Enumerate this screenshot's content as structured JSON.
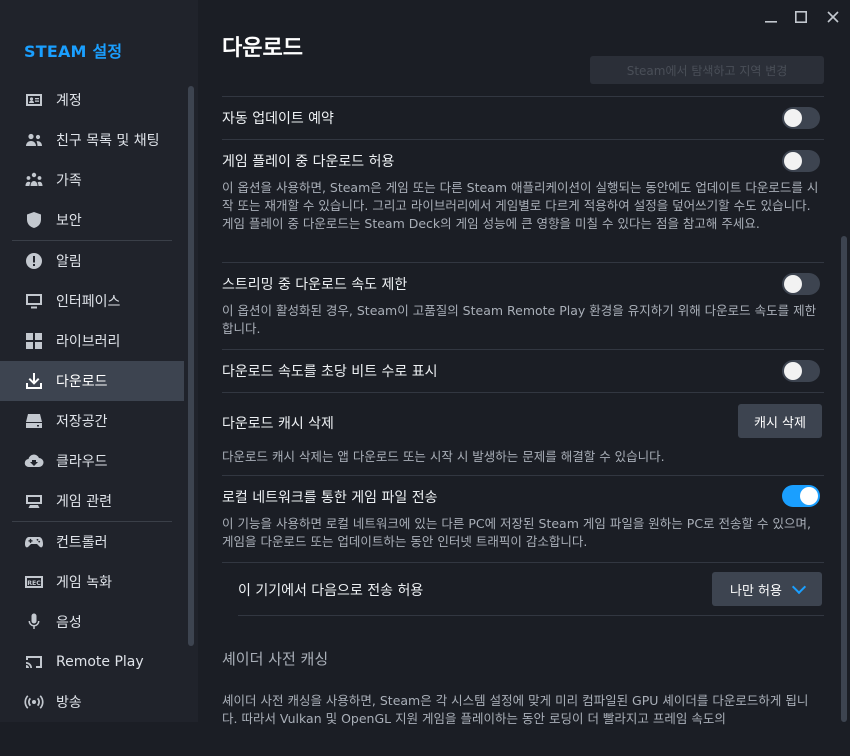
{
  "sidebar": {
    "title": "STEAM 설정",
    "items": [
      {
        "label": "계정",
        "icon": "account-card-icon"
      },
      {
        "label": "친구 목록 및 채팅",
        "icon": "friends-icon"
      },
      {
        "label": "가족",
        "icon": "family-icon"
      },
      {
        "label": "보안",
        "icon": "shield-icon"
      },
      {
        "label": "알림",
        "icon": "alert-icon"
      },
      {
        "label": "인터페이스",
        "icon": "monitor-icon"
      },
      {
        "label": "라이브러리",
        "icon": "grid-icon"
      },
      {
        "label": "다운로드",
        "icon": "download-icon"
      },
      {
        "label": "저장공간",
        "icon": "storage-icon"
      },
      {
        "label": "클라우드",
        "icon": "cloud-sync-icon"
      },
      {
        "label": "게임 관련",
        "icon": "in-game-icon"
      },
      {
        "label": "컨트롤러",
        "icon": "controller-icon"
      },
      {
        "label": "게임 녹화",
        "icon": "rec-icon"
      },
      {
        "label": "음성",
        "icon": "microphone-icon"
      },
      {
        "label": "Remote Play",
        "icon": "cast-icon"
      },
      {
        "label": "방송",
        "icon": "broadcast-icon"
      }
    ],
    "active_index": 7
  },
  "window": {
    "minimize": "—",
    "maximize": "☐",
    "close": "✕"
  },
  "page": {
    "title": "다운로드",
    "faded_button": "Steam에서 탐색하고 지역 변경"
  },
  "settings": {
    "auto_update": {
      "title": "자동 업데이트 예약"
    },
    "download_during_play": {
      "title": "게임 플레이 중 다운로드 허용",
      "desc": "이 옵션을 사용하면, Steam은 게임 또는 다른 Steam 애플리케이션이 실행되는 동안에도 업데이트 다운로드를 시작 또는 재개할 수 있습니다. 그리고 라이브러리에서 게임별로 다르게 적용하여 설정을 덮어쓰기할 수도 있습니다. 게임 플레이 중 다운로드는 Steam Deck의 게임 성능에 큰 영향을 미칠 수 있다는 점을 참고해 주세요.",
      "enabled": false
    },
    "throttle_streaming": {
      "title": "스트리밍 중 다운로드 속도 제한",
      "desc": "이 옵션이 활성화된 경우, Steam이 고품질의 Steam Remote Play 환경을 유지하기 위해 다운로드 속도를 제한합니다.",
      "enabled": false
    },
    "bits_per_second": {
      "title": "다운로드 속도를 초당 비트 수로 표시",
      "enabled": false
    },
    "clear_cache": {
      "title": "다운로드 캐시 삭제",
      "button": "캐시 삭제",
      "desc": "다운로드 캐시 삭제는 앱 다운로드 또는 시작 시 발생하는 문제를 해결할 수 있습니다."
    },
    "lan_transfer": {
      "title": "로컬 네트워크를 통한 게임 파일 전송",
      "desc": "이 기능을 사용하면 로컬 네트워크에 있는 다른 PC에 저장된 Steam 게임 파일을 원하는 PC로 전송할 수 있으며, 게임을 다운로드 또는 업데이트하는 동안 인터넷 트래픽이 감소합니다.",
      "enabled": true
    },
    "allow_transfer": {
      "title": "이 기기에서 다음으로 전송 허용",
      "value": "나만 허용"
    },
    "shader": {
      "heading": "셰이더 사전 캐싱",
      "desc": "셰이더 사전 캐싱을 사용하면, Steam은 각 시스템 설정에 맞게 미리 컴파일된 GPU 셰이더를 다운로드하게 됩니다. 따라서 Vulkan 및 OpenGL 지원 게임을 플레이하는 동안 로딩이 더 빨라지고 프레임 속도의"
    }
  },
  "colors": {
    "accent": "#1a9fff",
    "sidebar_bg": "#20232b",
    "main_bg": "#1b1e25",
    "active_item": "#3d4450"
  }
}
